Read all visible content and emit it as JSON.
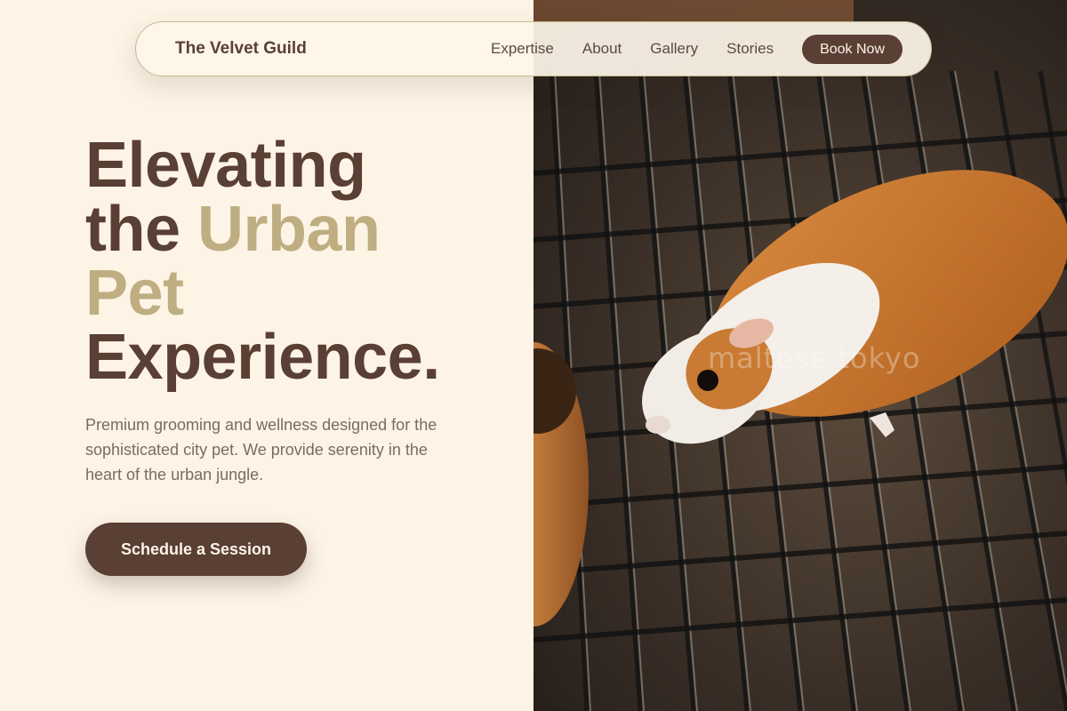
{
  "nav": {
    "brand": "The Velvet Guild",
    "links": [
      "Expertise",
      "About",
      "Gallery",
      "Stories"
    ],
    "cta": "Book Now"
  },
  "hero": {
    "title_line1": "Elevating",
    "title_the": "the",
    "title_urban": "Urban",
    "title_pet": "Pet",
    "title_line4": "Experience.",
    "subtitle": "Premium grooming and wellness designed for the sophisticated city pet. We provide serenity in the heart of the urban jungle.",
    "cta": "Schedule a Session"
  },
  "photo": {
    "subject": "guinea pig on wire cage grid",
    "watermark": "maltese.tokyo"
  },
  "colors": {
    "background": "#fdf4e6",
    "primary": "#5a3f35",
    "accent": "#bfae82",
    "body_text": "#7d6a62"
  }
}
